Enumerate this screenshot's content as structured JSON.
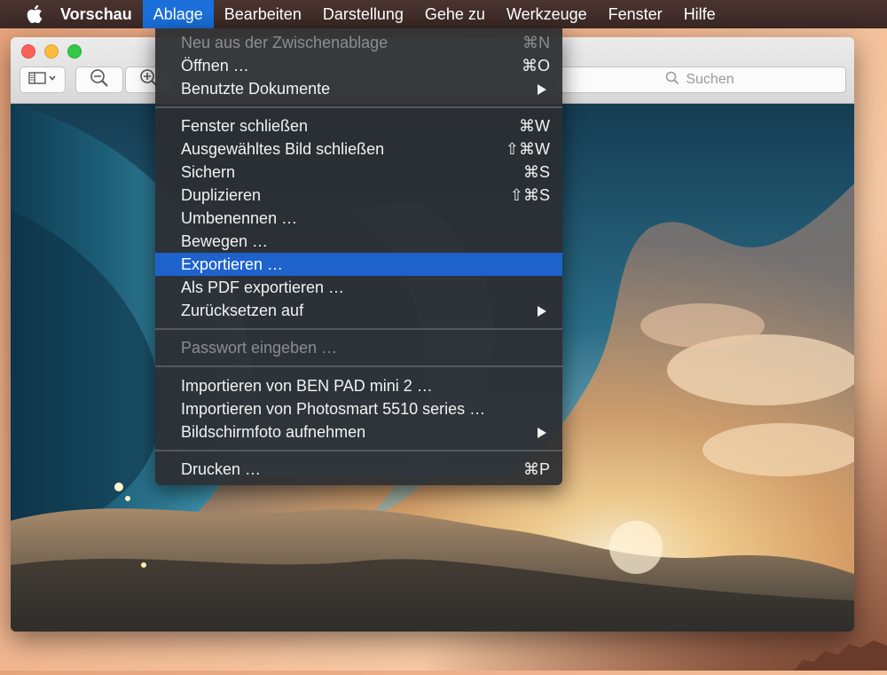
{
  "menubar": {
    "app_name": "Vorschau",
    "items": [
      "Ablage",
      "Bearbeiten",
      "Darstellung",
      "Gehe zu",
      "Werkzeuge",
      "Fenster",
      "Hilfe"
    ],
    "active": "Ablage"
  },
  "toolbar": {
    "search_placeholder": "Suchen"
  },
  "file_menu": {
    "items": [
      {
        "label": "Neu aus der Zwischenablage",
        "shortcut": "⌘N",
        "disabled": true
      },
      {
        "label": "Öffnen …",
        "shortcut": "⌘O"
      },
      {
        "label": "Benutzte Dokumente",
        "submenu": true
      },
      {
        "label": "Fenster schließen",
        "shortcut": "⌘W"
      },
      {
        "label": "Ausgewähltes Bild schließen",
        "shortcut": "⇧⌘W"
      },
      {
        "label": "Sichern",
        "shortcut": "⌘S"
      },
      {
        "label": "Duplizieren",
        "shortcut": "⇧⌘S"
      },
      {
        "label": "Umbenennen …"
      },
      {
        "label": "Bewegen …"
      },
      {
        "label": "Exportieren …",
        "highlighted": true
      },
      {
        "label": "Als PDF exportieren …"
      },
      {
        "label": "Zurücksetzen auf",
        "submenu": true
      },
      {
        "label": "Passwort eingeben …",
        "disabled": true
      },
      {
        "label": "Importieren von BEN PAD mini 2 …"
      },
      {
        "label": "Importieren von Photosmart 5510 series …"
      },
      {
        "label": "Bildschirmfoto aufnehmen",
        "submenu": true
      },
      {
        "label": "Drucken …",
        "shortcut": "⌘P"
      }
    ]
  },
  "colors": {
    "menu_highlight": "#1e63cc",
    "menubar_active": "#1a6fd9"
  }
}
